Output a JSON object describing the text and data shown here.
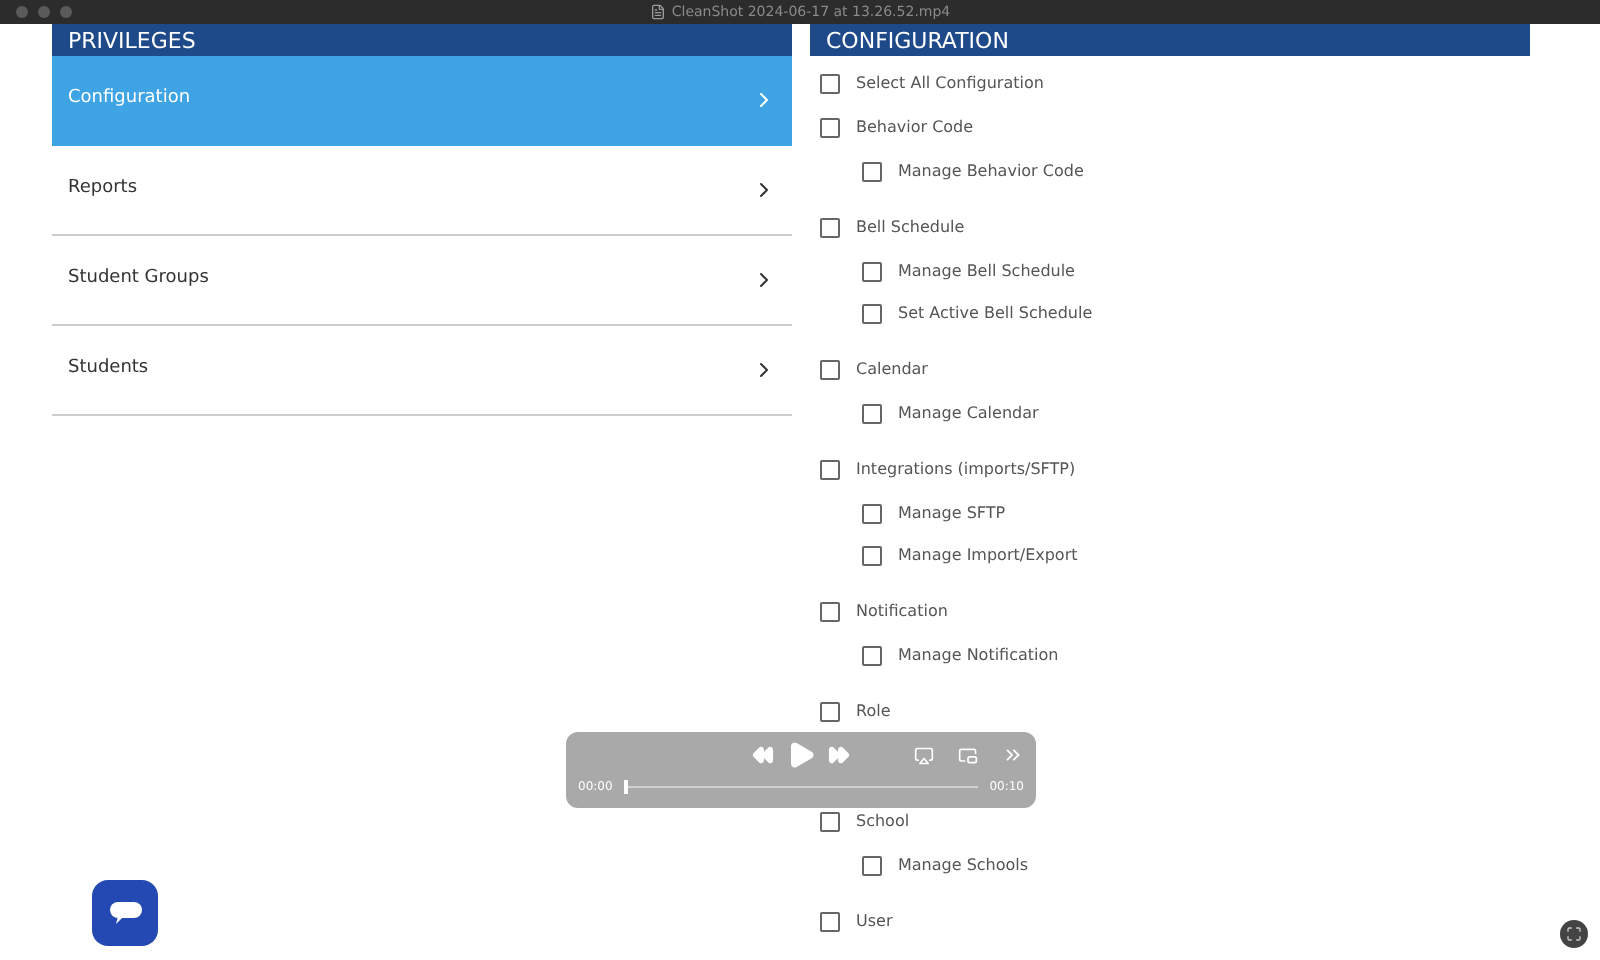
{
  "window": {
    "title": "CleanShot 2024-06-17 at 13.26.52.mp4"
  },
  "privileges": {
    "title": "PRIVILEGES",
    "items": [
      {
        "label": "Configuration",
        "selected": true
      },
      {
        "label": "Reports",
        "selected": false
      },
      {
        "label": "Student Groups",
        "selected": false
      },
      {
        "label": "Students",
        "selected": false
      }
    ]
  },
  "configuration": {
    "title": "CONFIGURATION",
    "select_all": {
      "label": "Select All Configuration",
      "checked": false
    },
    "groups": [
      {
        "label": "Behavior Code",
        "checked": false,
        "children": [
          {
            "label": "Manage Behavior Code",
            "checked": false
          }
        ]
      },
      {
        "label": "Bell Schedule",
        "checked": false,
        "children": [
          {
            "label": "Manage Bell Schedule",
            "checked": false
          },
          {
            "label": "Set Active Bell Schedule",
            "checked": false
          }
        ]
      },
      {
        "label": "Calendar",
        "checked": false,
        "children": [
          {
            "label": "Manage Calendar",
            "checked": false
          }
        ]
      },
      {
        "label": "Integrations (imports/SFTP)",
        "checked": false,
        "children": [
          {
            "label": "Manage SFTP",
            "checked": false
          },
          {
            "label": "Manage Import/Export",
            "checked": false
          }
        ]
      },
      {
        "label": "Notification",
        "checked": false,
        "children": [
          {
            "label": "Manage Notification",
            "checked": false
          }
        ]
      },
      {
        "label": "Role",
        "checked": false
      },
      {
        "label": "School",
        "checked": false,
        "children": [
          {
            "label": "Manage Schools",
            "checked": false
          }
        ]
      },
      {
        "label": "User",
        "checked": false
      }
    ]
  },
  "player": {
    "elapsed": "00:00",
    "duration": "00:10",
    "level": 0.0
  }
}
